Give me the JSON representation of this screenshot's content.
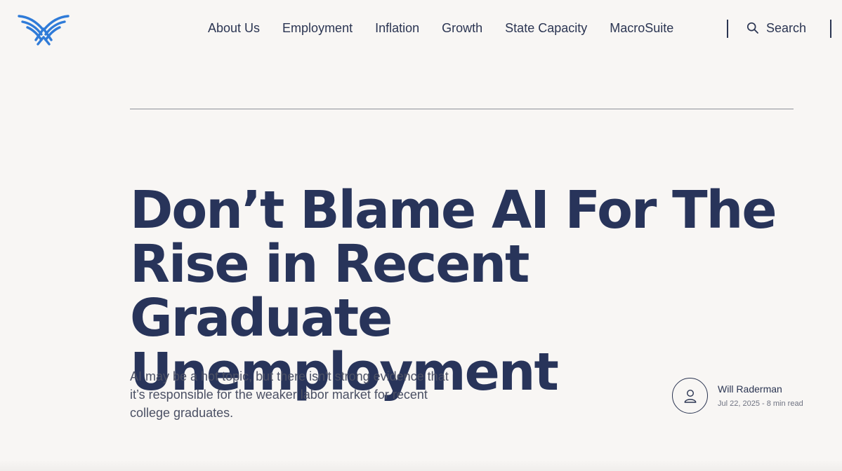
{
  "header": {
    "logo_icon": "eagle-logo-icon",
    "nav_items": [
      {
        "label": "About Us"
      },
      {
        "label": "Employment"
      },
      {
        "label": "Inflation"
      },
      {
        "label": "Growth"
      },
      {
        "label": "State Capacity"
      },
      {
        "label": "MacroSuite"
      }
    ],
    "search": {
      "label": "Search",
      "icon": "search-icon"
    }
  },
  "article": {
    "title": "Don’t Blame AI For The Rise in Recent Graduate Unemployment",
    "subtitle": "AI may be a hot topic, but there isn't strong evidence that it’s responsible for the weaker labor market for recent college graduates.",
    "author": {
      "name": "Will Raderman",
      "meta": "Jul 22, 2025 - 8 min read",
      "avatar_icon": "user-icon"
    }
  },
  "colors": {
    "background": "#f8f6f4",
    "text": "#2b3552",
    "title": "#28345a",
    "brand_blue": "#2f7bd8"
  }
}
